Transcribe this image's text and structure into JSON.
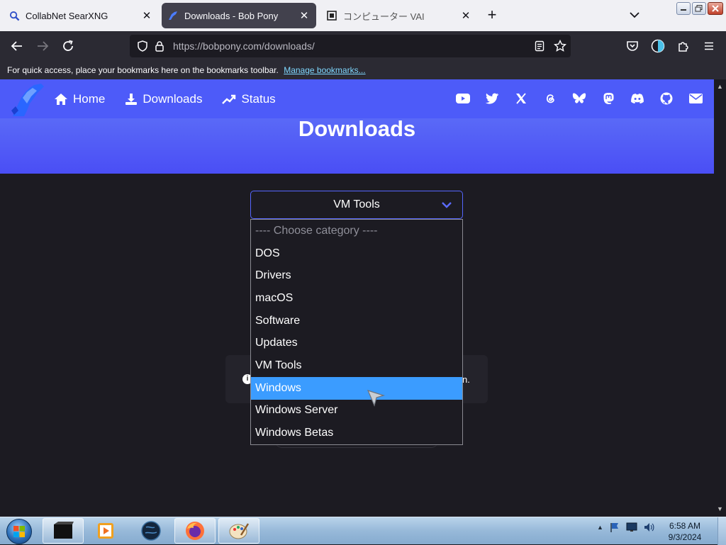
{
  "browser": {
    "tabs": [
      {
        "title": "CollabNet SearXNG",
        "active": false
      },
      {
        "title": "Downloads - Bob Pony",
        "active": true
      },
      {
        "title": "コンピューター VAI",
        "active": false
      }
    ],
    "url_host": "https://bobpony.com",
    "url_path": "/downloads/",
    "bookmarks_text": "For quick access, place your bookmarks here on the bookmarks toolbar.",
    "bookmarks_link": "Manage bookmarks..."
  },
  "site": {
    "nav": [
      {
        "label": "Home",
        "icon": "home-icon"
      },
      {
        "label": "Downloads",
        "icon": "download-icon"
      },
      {
        "label": "Status",
        "icon": "trending-up-icon"
      }
    ],
    "socials": [
      "youtube-icon",
      "twitter-icon",
      "x-icon",
      "threads-icon",
      "bluesky-icon",
      "mastodon-icon",
      "discord-icon",
      "github-icon",
      "mail-icon"
    ],
    "title": "Downloads"
  },
  "category_select": {
    "value": "VM Tools",
    "options": [
      "---- Choose category ----",
      "DOS",
      "Drivers",
      "macOS",
      "Software",
      "Updates",
      "VM Tools",
      "Windows",
      "Windows Server",
      "Windows Betas"
    ],
    "highlighted": "Windows"
  },
  "info_box_tail": "n.",
  "taskbar": {
    "time": "6:58 AM",
    "date": "9/3/2024"
  },
  "colors": {
    "accent": "#4d5bf9",
    "highlight": "#3b9cff",
    "page_bg": "#1c1b22"
  }
}
